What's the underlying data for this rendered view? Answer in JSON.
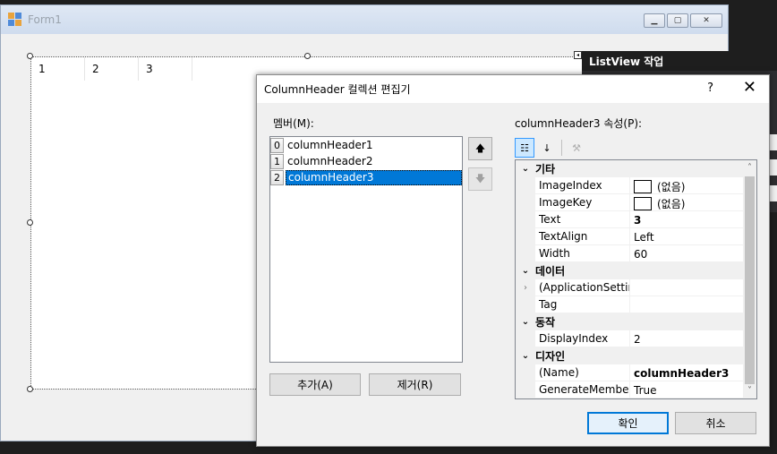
{
  "form1": {
    "title": "Form1",
    "listview_columns": [
      "1",
      "2",
      "3"
    ]
  },
  "listview_tasks": {
    "title": "ListView 작업"
  },
  "dialog": {
    "title": "ColumnHeader 컬렉션 편집기",
    "help": "?",
    "close": "✕",
    "members_label": "멤버(M):",
    "members": [
      {
        "index": "0",
        "name": "columnHeader1",
        "selected": false
      },
      {
        "index": "1",
        "name": "columnHeader2",
        "selected": false
      },
      {
        "index": "2",
        "name": "columnHeader3",
        "selected": true
      }
    ],
    "add_label": "추가(A)",
    "remove_label": "제거(R)",
    "props_label": "columnHeader3 속성(P):",
    "categories": [
      {
        "name": "기타",
        "rows": [
          {
            "name": "ImageIndex",
            "value": "(없음)",
            "swatch": true
          },
          {
            "name": "ImageKey",
            "value": "(없음)",
            "swatch": true
          },
          {
            "name": "Text",
            "value": "3",
            "bold": true
          },
          {
            "name": "TextAlign",
            "value": "Left"
          },
          {
            "name": "Width",
            "value": "60"
          }
        ]
      },
      {
        "name": "데이터",
        "rows": [
          {
            "name": "(ApplicationSettings)",
            "value": "",
            "expandable": true
          },
          {
            "name": "Tag",
            "value": ""
          }
        ]
      },
      {
        "name": "동작",
        "rows": [
          {
            "name": "DisplayIndex",
            "value": "2"
          }
        ]
      },
      {
        "name": "디자인",
        "rows": [
          {
            "name": "(Name)",
            "value": "columnHeader3",
            "bold": true,
            "name_bold": false
          },
          {
            "name": "GenerateMember",
            "value": "True"
          }
        ]
      }
    ],
    "ok_label": "확인",
    "cancel_label": "취소"
  },
  "colors": {
    "selection": "#0078d7",
    "window_bg": "#f0f0f0",
    "ide_bg": "#1e1e1e"
  }
}
